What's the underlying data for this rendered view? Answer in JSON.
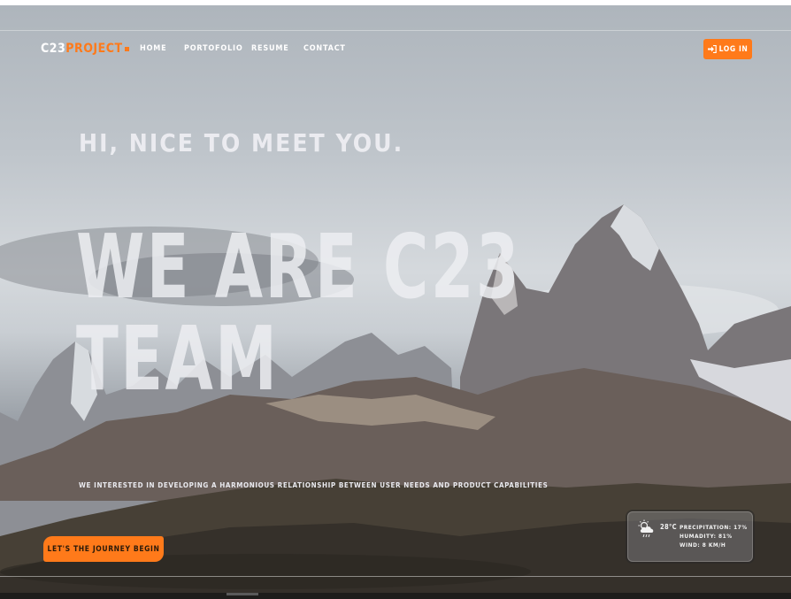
{
  "brand": {
    "prefix": "C23",
    "suffix": "PROJECT"
  },
  "nav": {
    "items": [
      "HOME",
      "PORTOFOLIO",
      "RESUME",
      "CONTACT"
    ]
  },
  "login": {
    "label": "LOG IN"
  },
  "hero": {
    "greeting": "HI, NICE TO MEET YOU.",
    "headline_line1": "WE ARE C23",
    "headline_line2": "TEAM",
    "tagline": "WE INTERESTED IN DEVELOPING A HARMONIOUS RELATIONSHIP BETWEEN USER NEEDS AND PRODUCT CAPABILITIES",
    "cta": "LET'S THE JOURNEY BEGIN"
  },
  "weather": {
    "temperature": "28°C",
    "precipitation": "PRECIPITATION: 17%",
    "humidity": "HUMADITY: 81%",
    "wind": "WIND: 8 KM/H"
  },
  "colors": {
    "accent": "#ff7a1a"
  }
}
